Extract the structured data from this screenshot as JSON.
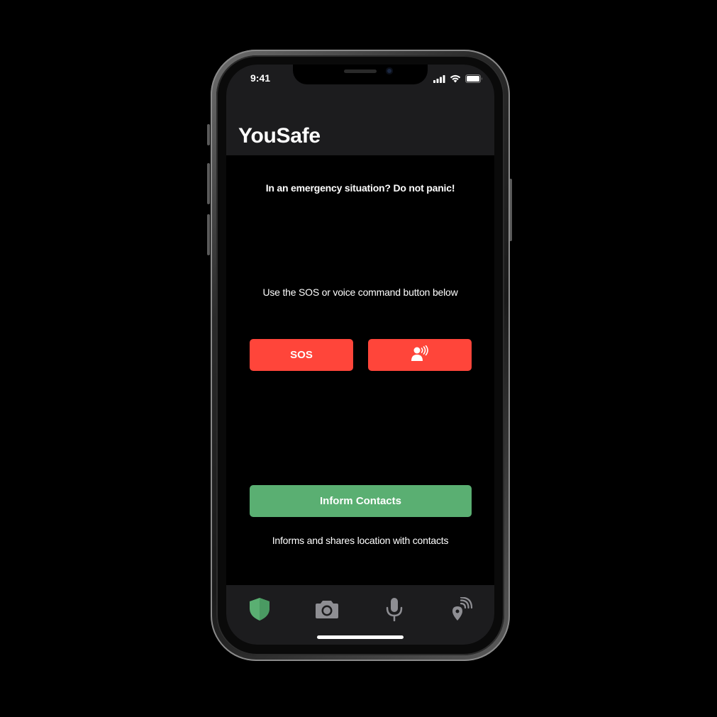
{
  "status_bar": {
    "time": "9:41",
    "icons": [
      "cellular-signal-icon",
      "wifi-icon",
      "battery-icon"
    ]
  },
  "header": {
    "title": "YouSafe"
  },
  "main": {
    "emergency_prompt": "In an emergency situation? Do not panic!",
    "instruction": "Use the SOS  or voice command button below",
    "sos_label": "SOS",
    "voice_button_icon": "voice-command-icon",
    "inform_label": "Inform Contacts",
    "inform_caption": "Informs and shares location with contacts"
  },
  "tab_bar": {
    "items": [
      {
        "icon": "shield-icon",
        "active": true
      },
      {
        "icon": "camera-icon",
        "active": false
      },
      {
        "icon": "microphone-icon",
        "active": false
      },
      {
        "icon": "location-broadcast-icon",
        "active": false
      }
    ]
  },
  "colors": {
    "accent_red": "#ff453a",
    "accent_green": "#5aaf72",
    "bar_background": "#1c1c1e",
    "inactive_icon": "#8e8e93"
  }
}
